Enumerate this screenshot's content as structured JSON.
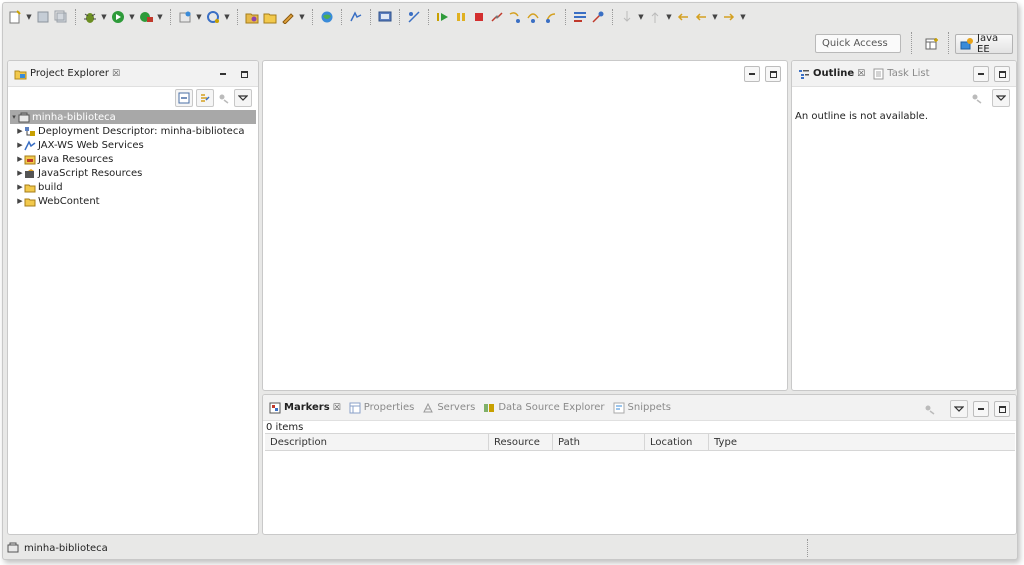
{
  "toolbar": {
    "quick_access_placeholder": "Quick Access",
    "perspective_label": "Java EE"
  },
  "project_explorer": {
    "tab_label": "Project Explorer",
    "close_glyph": "☒",
    "tree": [
      {
        "label": "minha-biblioteca",
        "selected": true,
        "icon": "project-icon"
      },
      {
        "label": "Deployment Descriptor: minha-biblioteca",
        "icon": "deployment-descriptor-icon"
      },
      {
        "label": "JAX-WS Web Services",
        "icon": "web-services-icon"
      },
      {
        "label": "Java Resources",
        "icon": "java-resources-icon"
      },
      {
        "label": "JavaScript Resources",
        "icon": "javascript-resources-icon"
      },
      {
        "label": "build",
        "icon": "folder-icon"
      },
      {
        "label": "WebContent",
        "icon": "folder-icon"
      }
    ]
  },
  "outline": {
    "tab_label": "Outline",
    "task_list_label": "Task List",
    "close_glyph": "☒",
    "message": "An outline is not available."
  },
  "markers": {
    "tabs": {
      "markers": "Markers",
      "properties": "Properties",
      "servers": "Servers",
      "data_source_explorer": "Data Source Explorer",
      "snippets": "Snippets"
    },
    "close_glyph": "☒",
    "items_count": "0 items",
    "columns": [
      "Description",
      "Resource",
      "Path",
      "Location",
      "Type"
    ]
  },
  "status": {
    "selection": "minha-biblioteca"
  },
  "colors": {
    "background": "#e8e8e7",
    "selection": "#a8a8a8",
    "panel": "#ffffff"
  }
}
